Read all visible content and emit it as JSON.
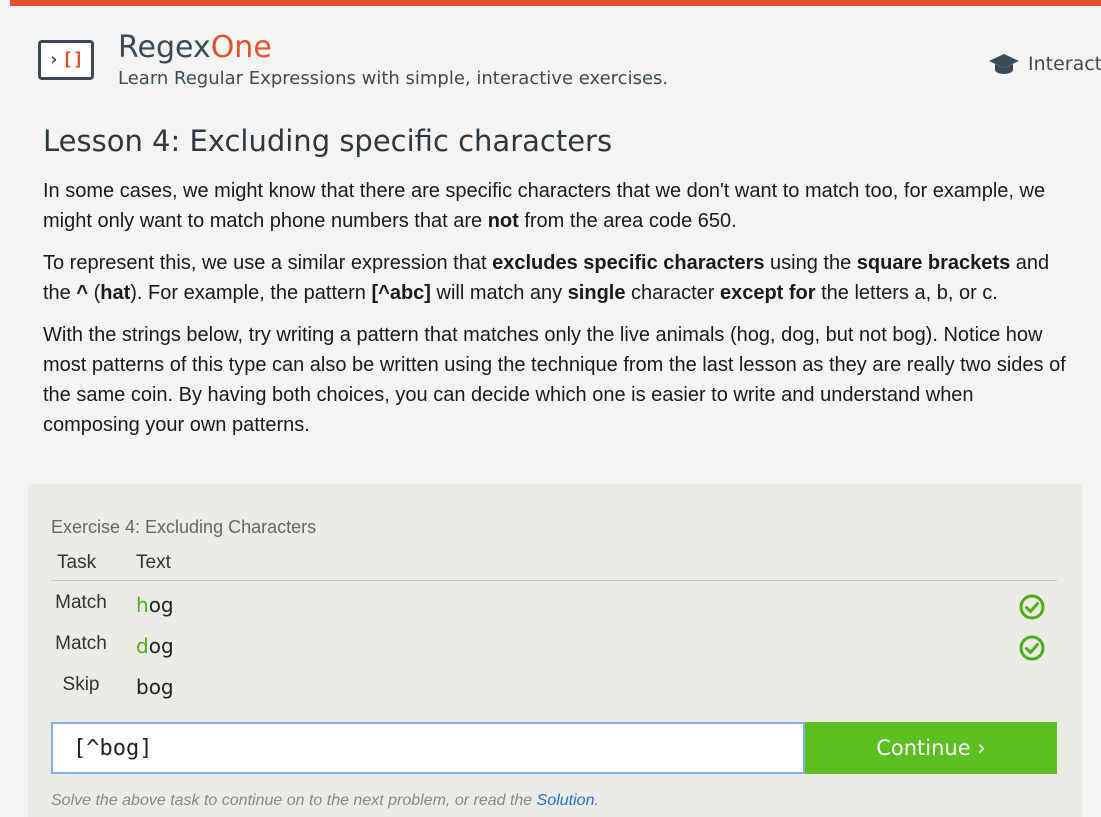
{
  "header": {
    "brand_main": "Regex",
    "brand_accent": "One",
    "tagline": "Learn Regular Expressions with simple, interactive exercises.",
    "nav_label": "Interactive"
  },
  "lesson": {
    "title": "Lesson 4: Excluding specific characters",
    "p1": {
      "a": "In some cases, we might know that there are specific characters that we don't want to match too, for example, we might only want to match phone numbers that are ",
      "b": "not",
      "c": " from the area code 650."
    },
    "p2": {
      "a": "To represent this, we use a similar expression that ",
      "b": "excludes specific characters",
      "c": " using the ",
      "d": "square brackets",
      "e": " and the ",
      "f": "^",
      "g": " (",
      "h": "hat",
      "i": "). For example, the pattern ",
      "j": "[^abc]",
      "k": " will match any ",
      "l": "single",
      "m": " character ",
      "n": "except for",
      "o": " the letters a, b, or c."
    },
    "p3": "With the strings below, try writing a pattern that matches only the live animals (hog, dog, but not bog). Notice how most patterns of this type can also be written using the technique from the last lesson as they are really two sides of the same coin. By having both choices, you can decide which one is easier to write and understand when composing your own patterns."
  },
  "exercise": {
    "title": "Exercise 4: Excluding Characters",
    "col_task": "Task",
    "col_text": "Text",
    "rows": [
      {
        "task": "Match",
        "match": "h",
        "rest": "og",
        "status": "check-icon"
      },
      {
        "task": "Match",
        "match": "d",
        "rest": "og",
        "status": "check-icon"
      },
      {
        "task": "Skip",
        "match": "",
        "rest": "bog",
        "status": ""
      }
    ],
    "input_value": "[^bog]",
    "continue_label": "Continue ›",
    "hint_text": "Solve the above task to continue on to the next problem, or read the ",
    "hint_link": "Solution",
    "hint_end": "."
  },
  "colors": {
    "accent": "#e0522b",
    "success": "#5bbf21",
    "link": "#1f6fd1"
  }
}
